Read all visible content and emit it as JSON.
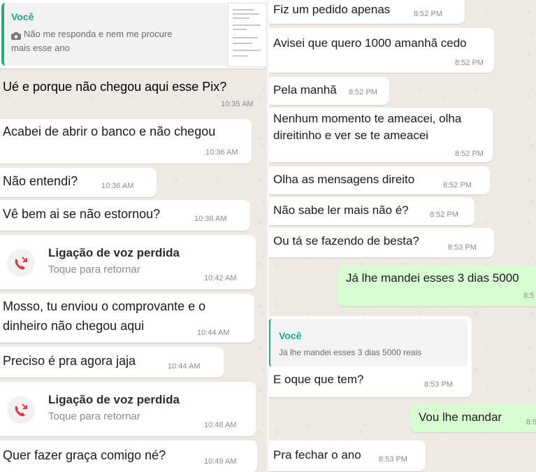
{
  "left": {
    "reply": {
      "sender": "Você",
      "camera_icon": "camera-icon",
      "text_line1": "Não me responda e nem me procure",
      "text_line2": "mais esse ano"
    },
    "messages": [
      {
        "text": "Ué e porque não chegou aqui esse Pix?",
        "time": "10:35 AM"
      },
      {
        "text": "Acabei de abrir o banco e não chegou",
        "time": "10:36 AM"
      },
      {
        "text": "Não entendi?",
        "time": "10:36 AM"
      },
      {
        "text": "Vê bem ai se não estornou?",
        "time": "10:38 AM"
      },
      {
        "text": "Mosso, tu enviou o comprovante e o",
        "text2": "dinheiro não chegou aqui",
        "time": "10:44 AM"
      },
      {
        "text": "Preciso é pra agora jaja",
        "time": "10:44 AM"
      },
      {
        "text": "Quer fazer graça comigo né?",
        "time": "10:49 AM"
      }
    ],
    "calls": [
      {
        "title": "Ligação de voz perdida",
        "subtitle": "Toque para retornar",
        "time": "10:42 AM",
        "icon": "missed-call-icon"
      },
      {
        "title": "Ligação de voz perdida",
        "subtitle": "Toque para retornar",
        "time": "10:48 AM",
        "icon": "missed-call-icon"
      }
    ]
  },
  "right": {
    "messages": [
      {
        "text": "Fiz um pedido apenas",
        "time": "8:52 PM"
      },
      {
        "text": "Avisei que quero 1000 amanhã cedo",
        "time": "8:52 PM"
      },
      {
        "text": "Pela manhã",
        "time": "8:52 PM"
      },
      {
        "text": "Nenhum momento te ameacei, olha",
        "text2": "direitinho e ver se te ameacei",
        "time": "8:52 PM"
      },
      {
        "text": "Olha as mensagens direito",
        "time": "8:52 PM"
      },
      {
        "text": "Não sabe ler mais não é?",
        "time": "8:52 PM"
      },
      {
        "text": "Ou tá se fazendo de besta?",
        "time": "8:53 PM"
      },
      {
        "text": "Já lhe mandei esses 3 dias 5000",
        "time": "8:5"
      },
      {
        "text": "E oque que tem?",
        "time": "8:53 PM"
      },
      {
        "text": "Vou lhe mandar",
        "time": "8:5"
      },
      {
        "text": "Pra fechar o ano",
        "time": "8:53 PM"
      }
    ],
    "reply": {
      "sender": "Você",
      "text": "Já lhe mandei esses 3 dias 5000 reais"
    }
  },
  "colors": {
    "outgoing": "#d9fdd3",
    "incoming": "#ffffff",
    "quote_accent": "#25a884",
    "missed_call": "#e0344a"
  }
}
